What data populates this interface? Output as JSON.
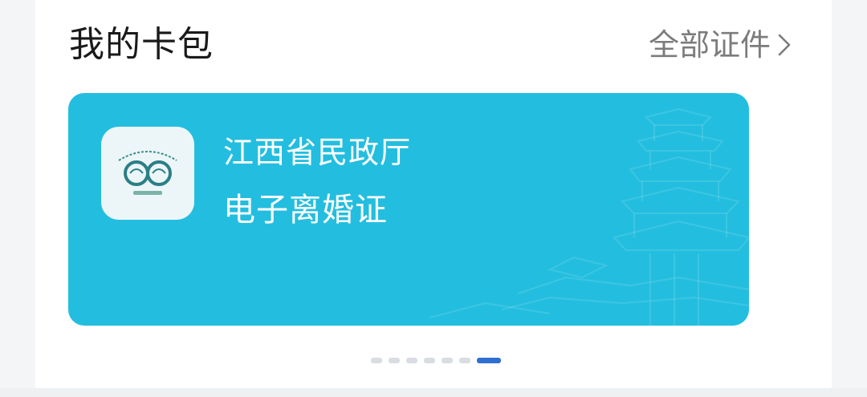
{
  "header": {
    "title": "我的卡包",
    "all_link": "全部证件"
  },
  "card": {
    "issuer": "江西省民政厅",
    "certificate": "电子离婚证",
    "logo_icon": "civil-affairs-emblem-icon",
    "background_color": "#23bedf"
  },
  "pager": {
    "total": 7,
    "active_index": 6,
    "active_color": "#2f6fd1",
    "inactive_color": "#d9dde2"
  }
}
